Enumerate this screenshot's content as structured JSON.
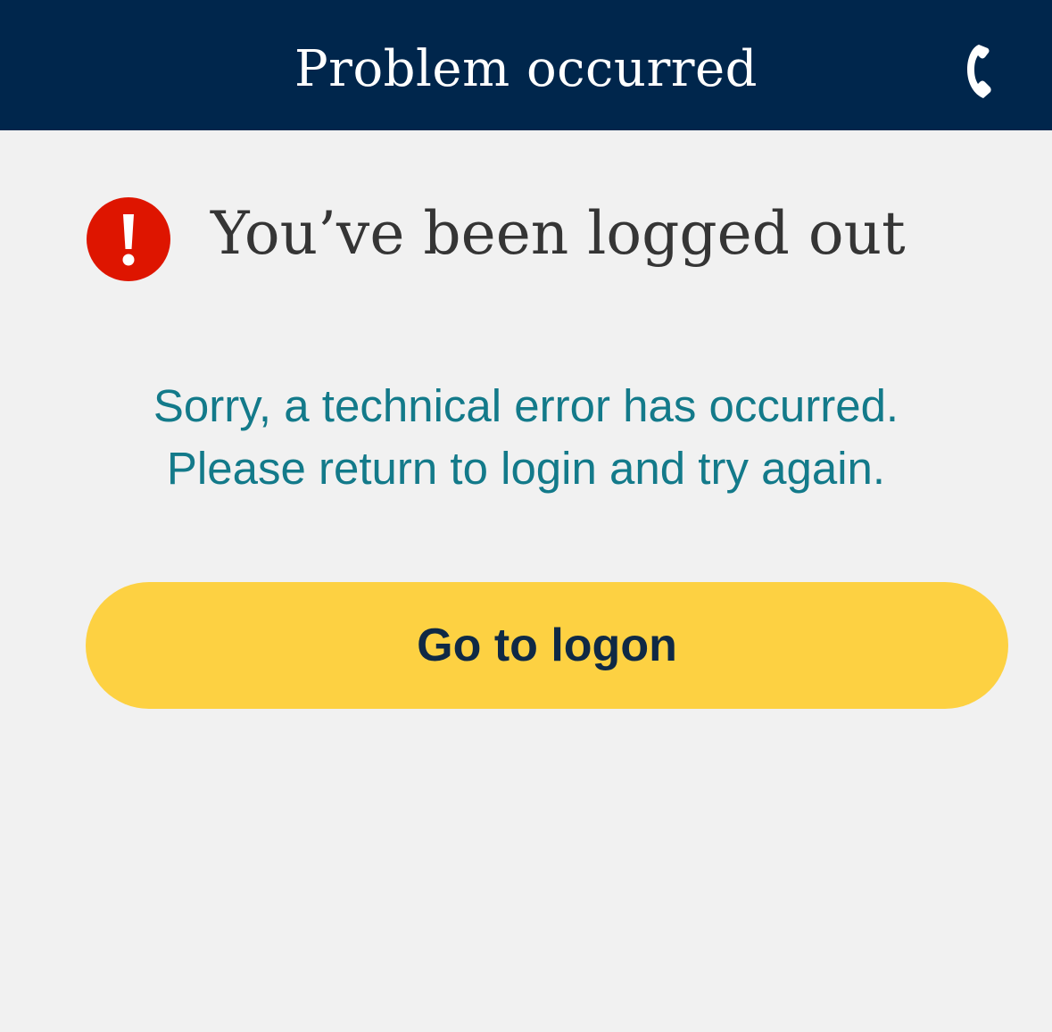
{
  "header": {
    "title": "Problem occurred",
    "phone_icon": "phone-icon"
  },
  "alert": {
    "icon": "error-exclamation-icon",
    "heading": "You’ve been logged out"
  },
  "message": {
    "line1": "Sorry, a technical error has occurred.",
    "line2": "Please return to login and try again."
  },
  "actions": {
    "logon_label": "Go to logon"
  },
  "colors": {
    "header_bg": "#00264c",
    "page_bg": "#f1f1f1",
    "error_red": "#de1500",
    "message_teal": "#137a8a",
    "button_yellow": "#fdd142",
    "button_text": "#0f2945"
  }
}
